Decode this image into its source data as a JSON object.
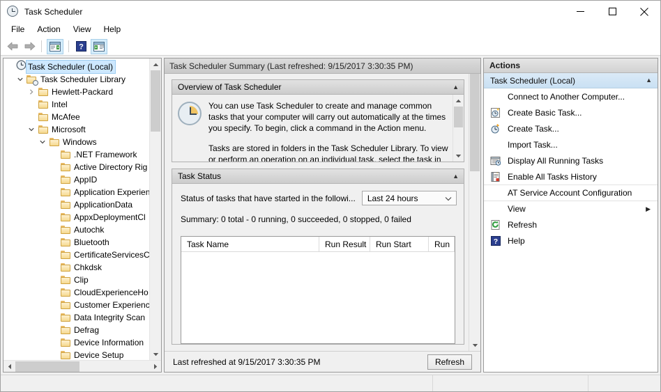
{
  "window": {
    "title": "Task Scheduler",
    "icon": "clock-icon",
    "controls": {
      "minimize": "minimize-icon",
      "maximize": "maximize-icon",
      "close": "close-icon"
    }
  },
  "menubar": {
    "items": [
      "File",
      "Action",
      "View",
      "Help"
    ]
  },
  "toolbar": {
    "buttons": [
      {
        "name": "back-button",
        "icon": "arrow-left-icon"
      },
      {
        "name": "forward-button",
        "icon": "arrow-right-icon"
      },
      {
        "name": "show-hide-console-tree-button",
        "icon": "console-tree-icon"
      },
      {
        "name": "help-button",
        "icon": "help-question-icon"
      },
      {
        "name": "show-hide-action-pane-button",
        "icon": "action-pane-icon"
      }
    ]
  },
  "tree": {
    "nodes": [
      {
        "label": "Task Scheduler (Local)",
        "indent": 0,
        "twist": "none",
        "icon": "clock-icon",
        "selected": true
      },
      {
        "label": "Task Scheduler Library",
        "indent": 1,
        "twist": "expanded",
        "icon": "folder-clock-icon",
        "selected": false
      },
      {
        "label": "Hewlett-Packard",
        "indent": 2,
        "twist": "collapsed",
        "icon": "folder-icon",
        "selected": false
      },
      {
        "label": "Intel",
        "indent": 2,
        "twist": "none",
        "icon": "folder-icon",
        "selected": false
      },
      {
        "label": "McAfee",
        "indent": 2,
        "twist": "none",
        "icon": "folder-icon",
        "selected": false
      },
      {
        "label": "Microsoft",
        "indent": 2,
        "twist": "expanded",
        "icon": "folder-icon",
        "selected": false
      },
      {
        "label": "Windows",
        "indent": 3,
        "twist": "expanded",
        "icon": "folder-icon",
        "selected": false
      },
      {
        "label": ".NET Framework",
        "indent": 4,
        "twist": "none",
        "icon": "folder-icon",
        "selected": false
      },
      {
        "label": "Active Directory Rig",
        "indent": 4,
        "twist": "none",
        "icon": "folder-icon",
        "selected": false
      },
      {
        "label": "AppID",
        "indent": 4,
        "twist": "none",
        "icon": "folder-icon",
        "selected": false
      },
      {
        "label": "Application Experien",
        "indent": 4,
        "twist": "none",
        "icon": "folder-icon",
        "selected": false
      },
      {
        "label": "ApplicationData",
        "indent": 4,
        "twist": "none",
        "icon": "folder-icon",
        "selected": false
      },
      {
        "label": "AppxDeploymentCl",
        "indent": 4,
        "twist": "none",
        "icon": "folder-icon",
        "selected": false
      },
      {
        "label": "Autochk",
        "indent": 4,
        "twist": "none",
        "icon": "folder-icon",
        "selected": false
      },
      {
        "label": "Bluetooth",
        "indent": 4,
        "twist": "none",
        "icon": "folder-icon",
        "selected": false
      },
      {
        "label": "CertificateServicesC",
        "indent": 4,
        "twist": "none",
        "icon": "folder-icon",
        "selected": false
      },
      {
        "label": "Chkdsk",
        "indent": 4,
        "twist": "none",
        "icon": "folder-icon",
        "selected": false
      },
      {
        "label": "Clip",
        "indent": 4,
        "twist": "none",
        "icon": "folder-icon",
        "selected": false
      },
      {
        "label": "CloudExperienceHo",
        "indent": 4,
        "twist": "none",
        "icon": "folder-icon",
        "selected": false
      },
      {
        "label": "Customer Experienc",
        "indent": 4,
        "twist": "none",
        "icon": "folder-icon",
        "selected": false
      },
      {
        "label": "Data Integrity Scan",
        "indent": 4,
        "twist": "none",
        "icon": "folder-icon",
        "selected": false
      },
      {
        "label": "Defrag",
        "indent": 4,
        "twist": "none",
        "icon": "folder-icon",
        "selected": false
      },
      {
        "label": "Device Information",
        "indent": 4,
        "twist": "none",
        "icon": "folder-icon",
        "selected": false
      },
      {
        "label": "Device Setup",
        "indent": 4,
        "twist": "none",
        "icon": "folder-icon",
        "selected": false
      }
    ]
  },
  "center": {
    "header": "Task Scheduler Summary (Last refreshed: 9/15/2017 3:30:35 PM)",
    "overview": {
      "title": "Overview of Task Scheduler",
      "paragraph1": "You can use Task Scheduler to create and manage common tasks that your computer will carry out automatically at the times you specify. To begin, click a command in the Action menu.",
      "paragraph2": "Tasks are stored in folders in the Task Scheduler Library. To view or perform an operation on an individual task, select the task in"
    },
    "task_status": {
      "title": "Task Status",
      "filter_label": "Status of tasks that have started in the followi...",
      "filter_value": "Last 24 hours",
      "summary": "Summary: 0 total - 0 running, 0 succeeded, 0 stopped, 0 failed",
      "columns": [
        "Task Name",
        "Run Result",
        "Run Start",
        "Run"
      ],
      "rows": []
    },
    "footer": {
      "status": "Last refreshed at 9/15/2017 3:30:35 PM",
      "refresh_button": "Refresh"
    }
  },
  "actions": {
    "title": "Actions",
    "group": "Task Scheduler (Local)",
    "items": [
      {
        "label": "Connect to Another Computer...",
        "icon": "none"
      },
      {
        "label": "Create Basic Task...",
        "icon": "create-basic-task-icon"
      },
      {
        "label": "Create Task...",
        "icon": "create-task-icon"
      },
      {
        "label": "Import Task...",
        "icon": "none"
      },
      {
        "label": "Display All Running Tasks",
        "icon": "running-tasks-icon"
      },
      {
        "label": "Enable All Tasks History",
        "icon": "history-icon"
      },
      {
        "label": "AT Service Account Configuration",
        "icon": "none"
      },
      {
        "label": "View",
        "icon": "none",
        "submenu": true
      },
      {
        "label": "Refresh",
        "icon": "refresh-icon"
      },
      {
        "label": "Help",
        "icon": "help-question-icon"
      }
    ]
  },
  "colors": {
    "accent_selection": "#cde8ff",
    "actions_group": "#c9e0f3",
    "folder": "#f6d98f",
    "window_bg": "#f0f0f0"
  }
}
